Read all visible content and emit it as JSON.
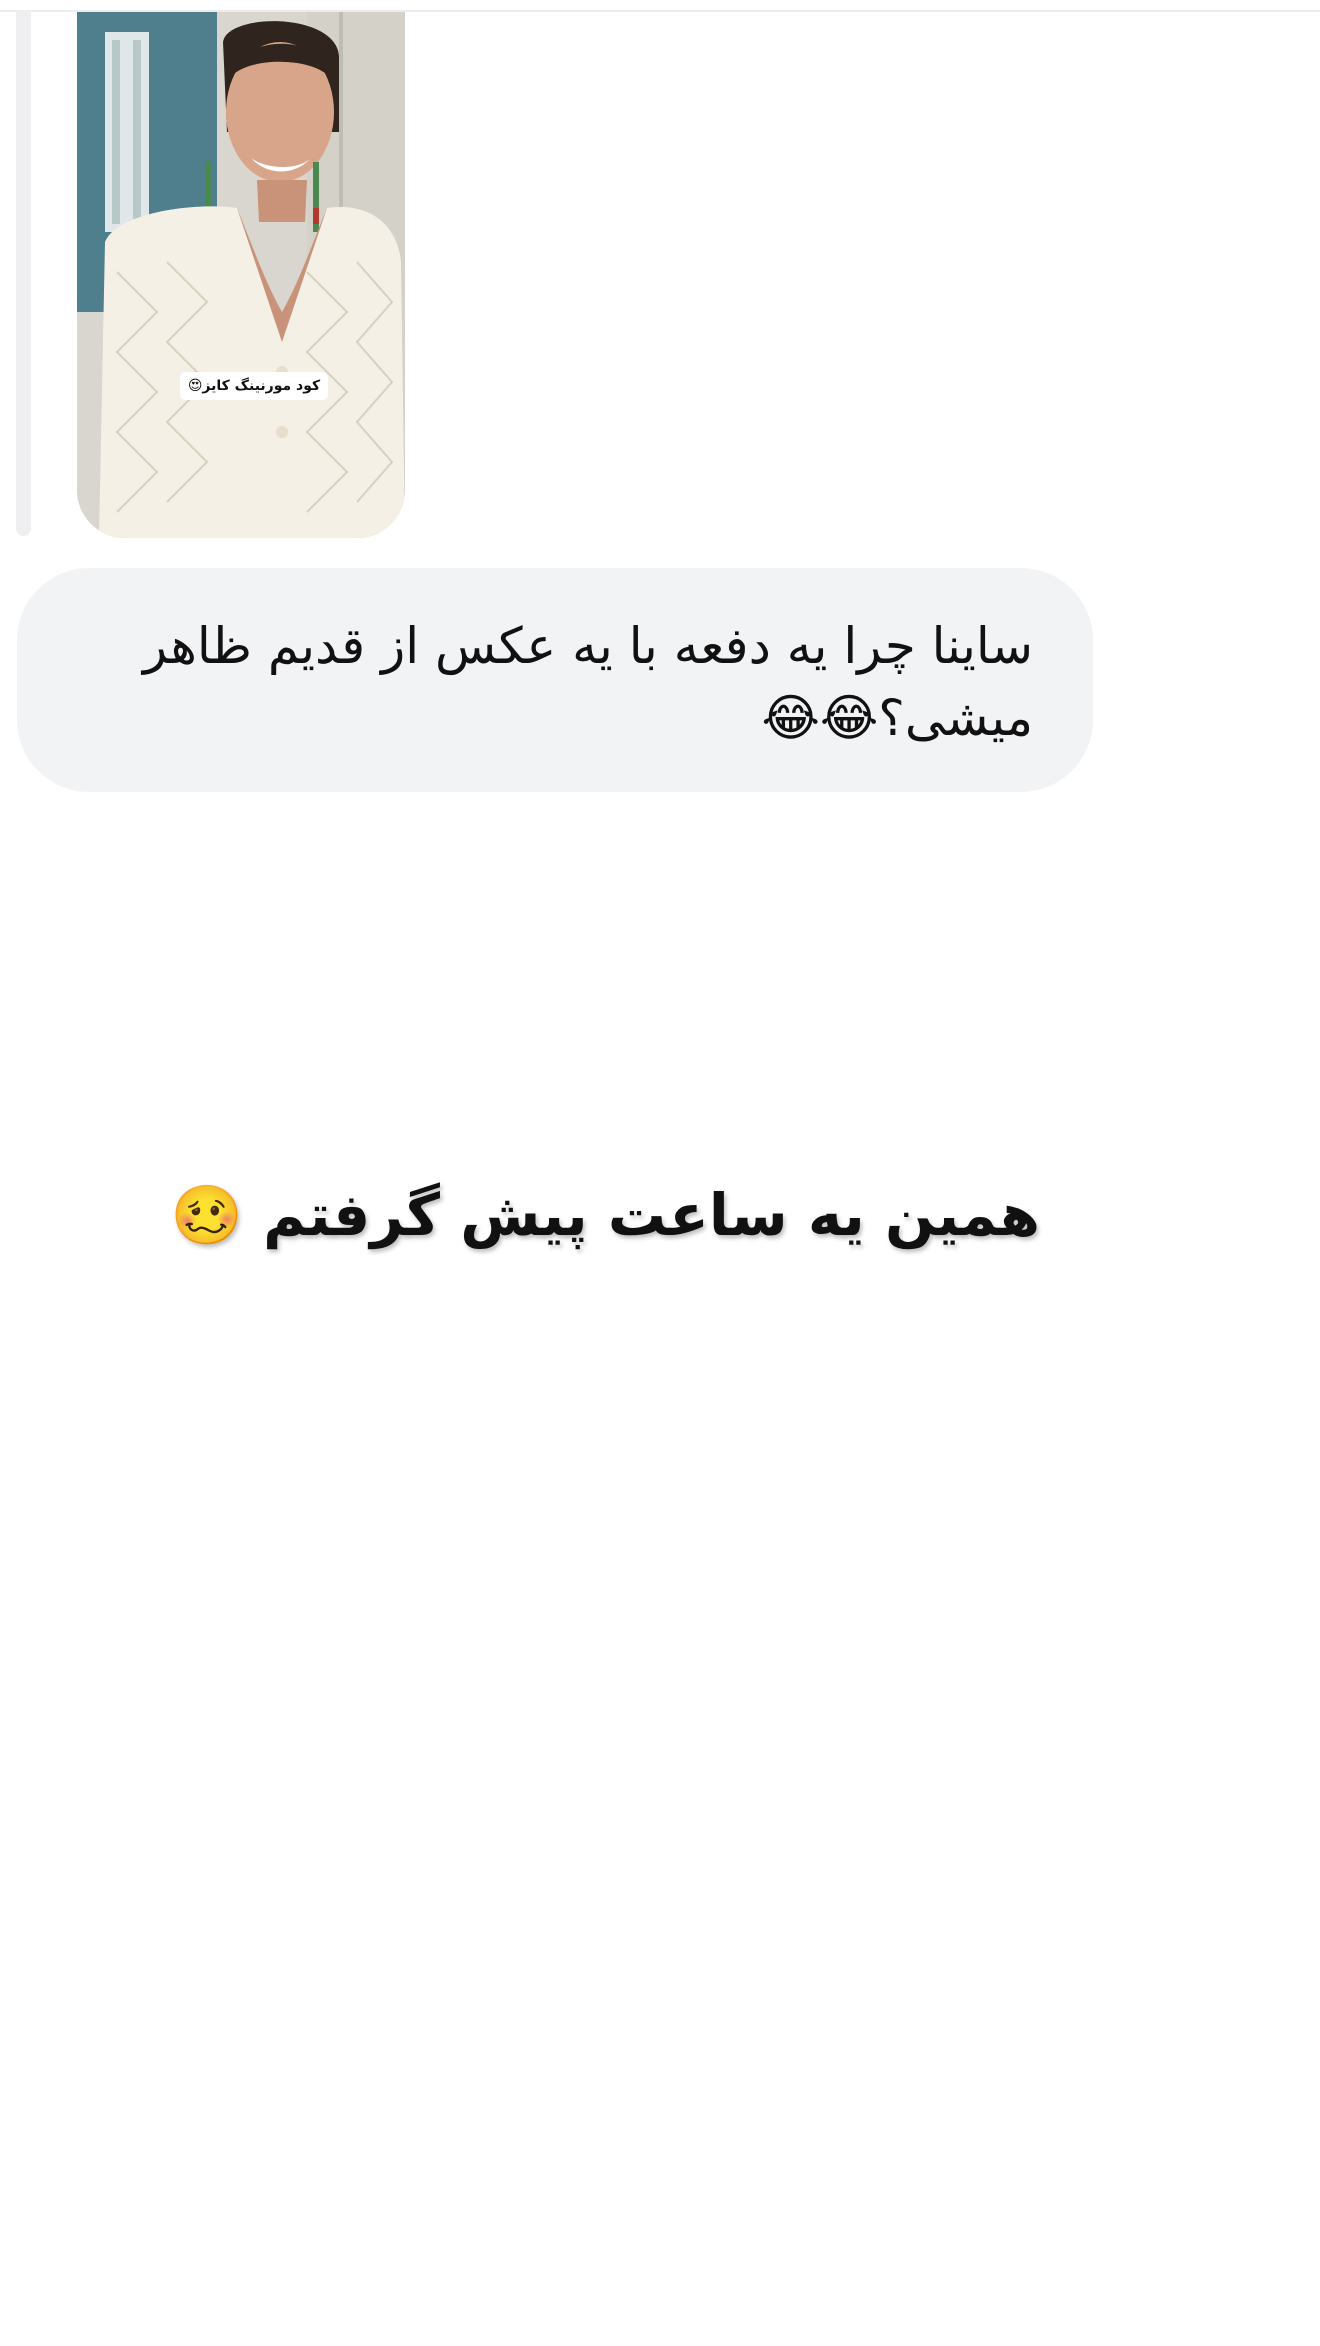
{
  "shared_post": {
    "image_description_icon": "person-photo-icon",
    "overlay_tag": "کود مورنینگ کایز😍"
  },
  "message": {
    "text": "ساینا چرا یه دفعه با یه عکس از قدیم ظاهر میشی؟😂😂"
  },
  "caption": {
    "text": "همین یه ساعت پیش گرفتم 🥴"
  },
  "colors": {
    "bubble_background": "#f2f3f5",
    "reply_bar": "#efeff1",
    "text": "#111111"
  }
}
